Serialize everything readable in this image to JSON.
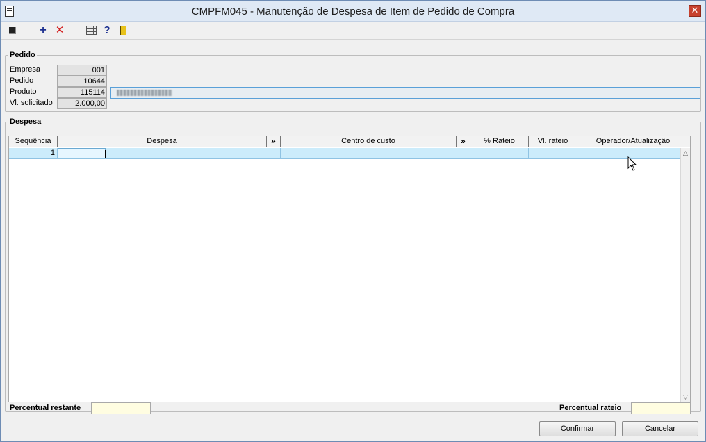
{
  "window": {
    "title": "CMPFM045 - Manutenção de Despesa de Item de Pedido de Compra",
    "close_label": "✕"
  },
  "toolbar": {
    "icons": [
      "first-record-icon",
      "add-icon",
      "delete-icon",
      "grid-icon",
      "help-icon",
      "exit-icon"
    ],
    "add_glyph": "+",
    "delete_glyph": "✕",
    "help_glyph": "?"
  },
  "pedido": {
    "legend": "Pedido",
    "empresa_label": "Empresa",
    "empresa_value": "001",
    "pedido_label": "Pedido",
    "pedido_value": "10644",
    "produto_label": "Produto",
    "produto_value": "115114",
    "vl_solicitado_label": "Vl. solicitado",
    "vl_solicitado_value": "2.000,00"
  },
  "despesa": {
    "legend": "Despesa",
    "columns": {
      "sequencia": "Sequência",
      "despesa": "Despesa",
      "despesa_lookup": "»",
      "centro_custo": "Centro de custo",
      "centro_custo_lookup": "»",
      "perc_rateio": "% Rateio",
      "vl_rateio": "Vl. rateio",
      "operador": "Operador/Atualização"
    },
    "rows": [
      {
        "sequencia": "1"
      }
    ],
    "percentual_restante_label": "Percentual restante",
    "percentual_rateio_label": "Percentual rateio"
  },
  "buttons": {
    "confirmar": "Confirmar",
    "cancelar": "Cancelar"
  },
  "colors": {
    "selected_row": "#ccecfb",
    "input_highlight": "#fffde1",
    "close_button": "#c7412e"
  }
}
